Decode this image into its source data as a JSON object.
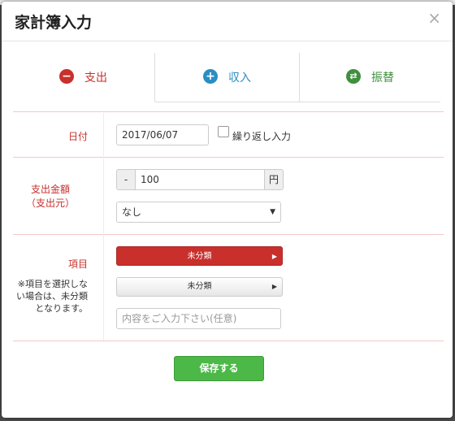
{
  "modal": {
    "title": "家計簿入力",
    "close_label": "×"
  },
  "tabs": [
    {
      "label": "支出",
      "icon": "minus-circle-icon",
      "color": "#c9302c"
    },
    {
      "label": "収入",
      "icon": "plus-circle-icon",
      "color": "#2a8ec4"
    },
    {
      "label": "振替",
      "icon": "transfer-circle-icon",
      "color": "#3f8f3f"
    }
  ],
  "form": {
    "date": {
      "label": "日付",
      "value": "2017/06/07",
      "repeat_label": "繰り返し入力",
      "repeat_checked": false
    },
    "amount": {
      "label": "支出金額",
      "sublabel": "（支出元）",
      "sign": "-",
      "value": "100",
      "unit": "円",
      "source_selected": "なし"
    },
    "category": {
      "label": "項目",
      "note": "※項目を選択しない場合は、未分類となります。",
      "main_value": "未分類",
      "sub_value": "未分類",
      "detail_placeholder": "内容をご入力下さい(任意)"
    }
  },
  "actions": {
    "save_label": "保存する"
  }
}
